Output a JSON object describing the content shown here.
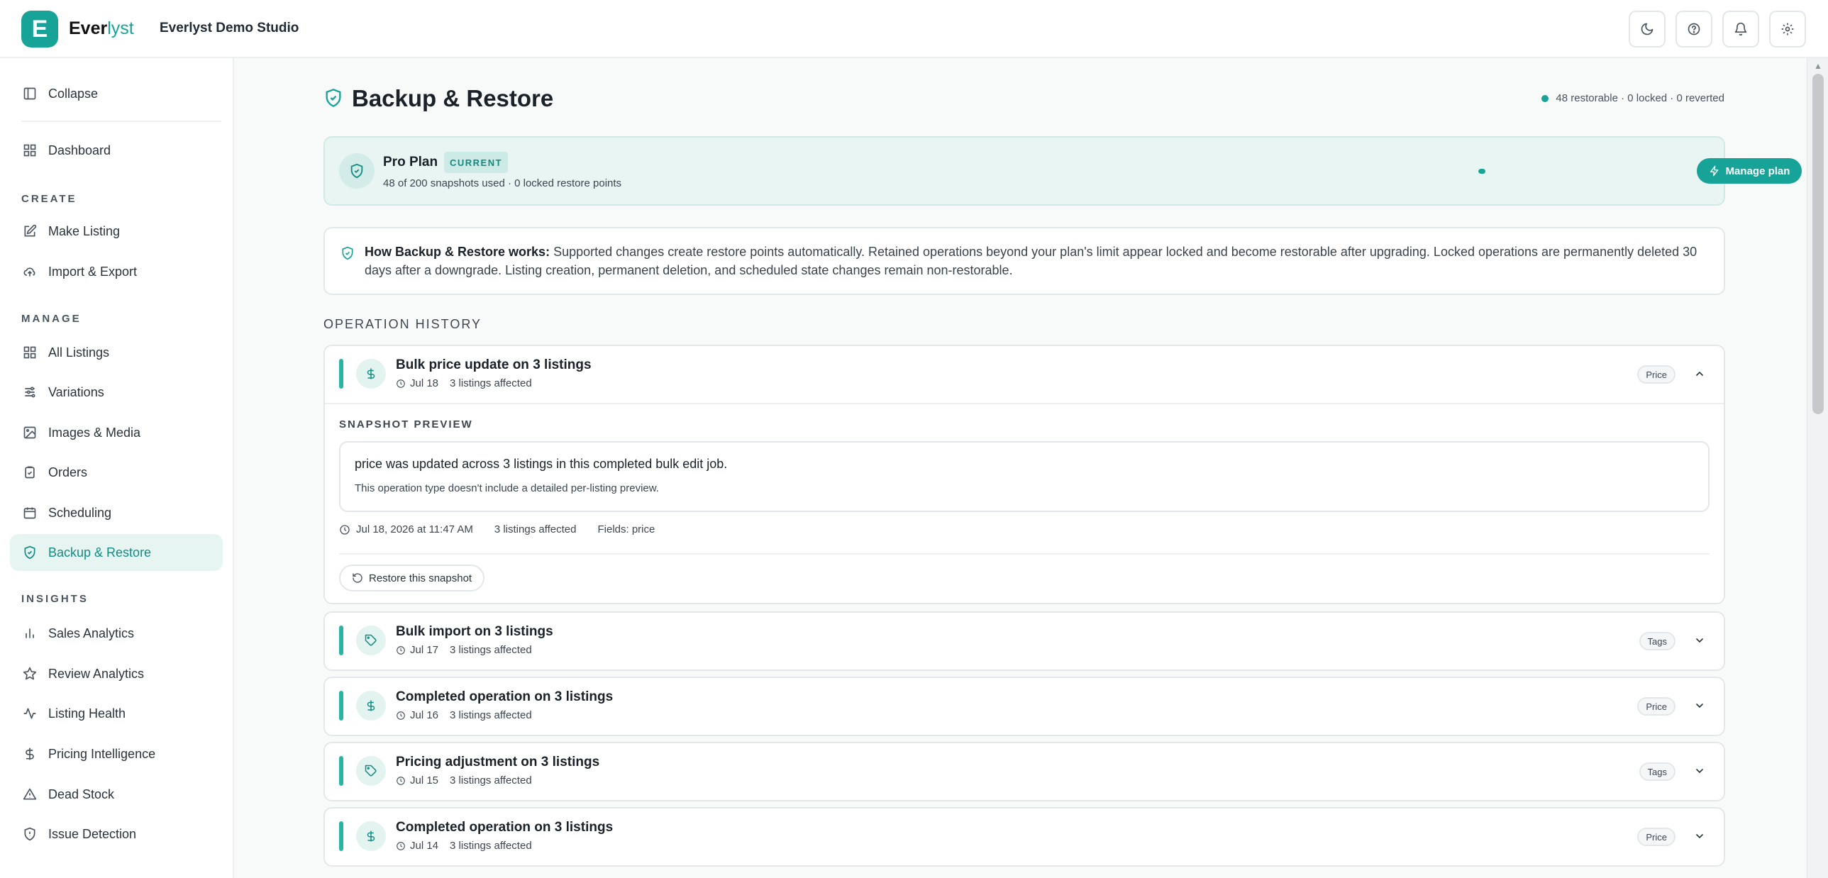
{
  "brand": {
    "logo_letter": "E",
    "name_part1": "Ever",
    "name_part2": "lyst",
    "studio": "Everlyst Demo Studio"
  },
  "topbar": {
    "icons": [
      "moon-icon",
      "help-icon",
      "bell-icon",
      "gear-icon"
    ]
  },
  "sidebar": {
    "collapse": "Collapse",
    "dashboard": "Dashboard",
    "section_create": "CREATE",
    "make_listing": "Make Listing",
    "import_export": "Import & Export",
    "section_manage": "MANAGE",
    "all_listings": "All Listings",
    "variations": "Variations",
    "images_media": "Images & Media",
    "orders": "Orders",
    "scheduling": "Scheduling",
    "backup_restore": "Backup & Restore",
    "section_insights": "INSIGHTS",
    "sales_analytics": "Sales Analytics",
    "review_analytics": "Review Analytics",
    "listing_health": "Listing Health",
    "pricing_intelligence": "Pricing Intelligence",
    "dead_stock": "Dead Stock",
    "issue_detection": "Issue Detection"
  },
  "page": {
    "title": "Backup & Restore",
    "status_summary": "48 restorable · 0 locked · 0 reverted"
  },
  "plan": {
    "name": "Pro Plan",
    "badge": "CURRENT",
    "usage": "48 of 200 snapshots used · 0 locked restore points",
    "usage_fraction": 0.24,
    "manage_label": "Manage plan"
  },
  "info": {
    "heading": "How Backup & Restore works:",
    "body": "Supported changes create restore points automatically. Retained operations beyond your plan's limit appear locked and become restorable after upgrading. Locked operations are permanently deleted 30 days after a downgrade. Listing creation, permanent deletion, and scheduled state changes remain non-restorable."
  },
  "history": {
    "label": "OPERATION HISTORY",
    "operations": [
      {
        "title": "Bulk price update on 3 listings",
        "date": "Jul 18",
        "affected": "3 listings affected",
        "tag": "Price",
        "icon": "dollar-icon"
      },
      {
        "title": "Bulk import on 3 listings",
        "date": "Jul 17",
        "affected": "3 listings affected",
        "tag": "Tags",
        "icon": "tag-icon"
      },
      {
        "title": "Completed operation on 3 listings",
        "date": "Jul 16",
        "affected": "3 listings affected",
        "tag": "Price",
        "icon": "dollar-icon"
      },
      {
        "title": "Pricing adjustment on 3 listings",
        "date": "Jul 15",
        "affected": "3 listings affected",
        "tag": "Tags",
        "icon": "tag-icon"
      },
      {
        "title": "Completed operation on 3 listings",
        "date": "Jul 14",
        "affected": "3 listings affected",
        "tag": "Price",
        "icon": "dollar-icon"
      }
    ],
    "snapshot": {
      "label": "SNAPSHOT PREVIEW",
      "main": "price was updated across 3 listings in this completed bulk edit job.",
      "sub": "This operation type doesn't include a detailed per-listing preview.",
      "timestamp": "Jul 18, 2026 at 11:47 AM",
      "affected": "3 listings affected",
      "fields": "Fields: price",
      "restore_label": "Restore this snapshot"
    }
  },
  "colors": {
    "accent": "#17a398",
    "accent_light": "#e8f5f3"
  }
}
